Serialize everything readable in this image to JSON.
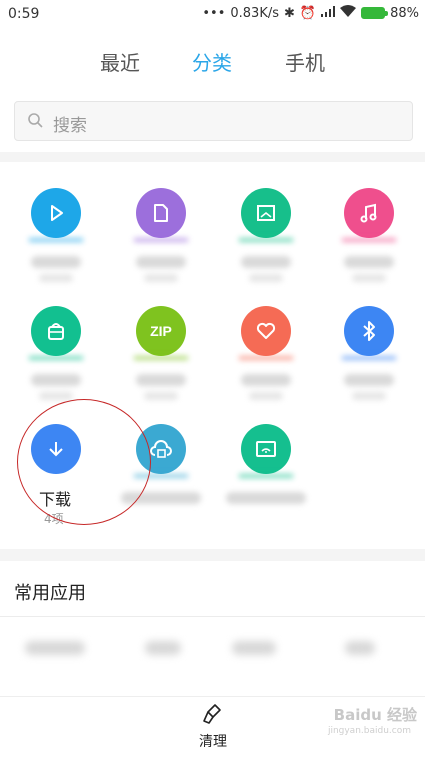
{
  "status": {
    "time": "0:59",
    "net_speed": "0.83K/s",
    "battery": "88%"
  },
  "tabs": [
    "最近",
    "分类",
    "手机"
  ],
  "active_tab": "分类",
  "search": {
    "placeholder": "搜索"
  },
  "categories": [
    {
      "icon": "play-icon",
      "color": "#1ea7e8"
    },
    {
      "icon": "document-icon",
      "color": "#9c6fdc"
    },
    {
      "icon": "image-icon",
      "color": "#17bf8b"
    },
    {
      "icon": "music-icon",
      "color": "#ef4f8d"
    },
    {
      "icon": "apk-icon",
      "color": "#12c090"
    },
    {
      "icon": "zip-icon",
      "label": "ZIP",
      "color": "#7fc31f"
    },
    {
      "icon": "favorite-icon",
      "color": "#f56b55"
    },
    {
      "icon": "bluetooth-icon",
      "color": "#3d86f3"
    },
    {
      "icon": "download-icon",
      "color": "#3d86f3"
    },
    {
      "icon": "cloud-icon",
      "color": "#3ba9d2"
    },
    {
      "icon": "remote-icon",
      "color": "#15bf8f"
    }
  ],
  "download": {
    "label": "下载",
    "count": "4项"
  },
  "common_apps": {
    "title": "常用应用"
  },
  "bottom": {
    "clean_label": "清理"
  },
  "watermark": {
    "text": "Baidu 经验",
    "sub": "jingyan.baidu.com"
  }
}
